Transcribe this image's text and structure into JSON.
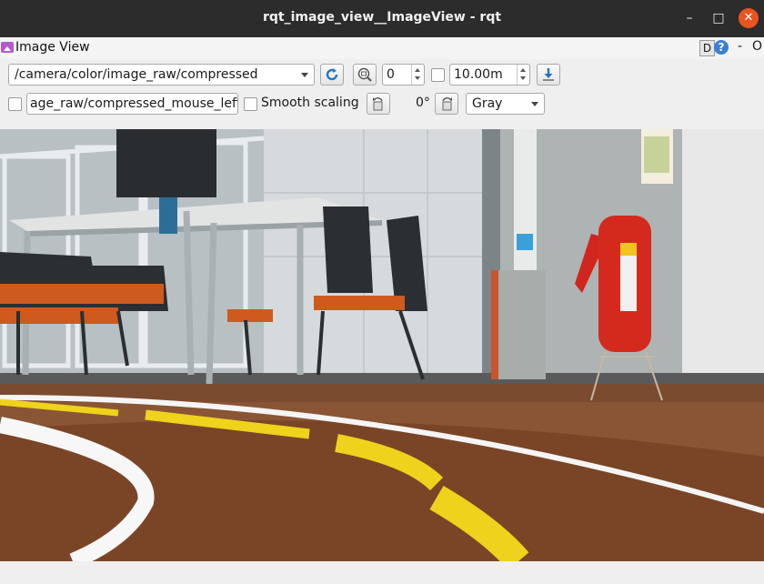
{
  "window": {
    "title": "rqt_image_view__ImageView - rqt",
    "minimize_icon": "minimize-icon",
    "maximize_icon": "maximize-icon",
    "close_icon": "close-icon",
    "minimize_glyph": "–",
    "maximize_glyph": "□",
    "close_glyph": "✕"
  },
  "plugin": {
    "title": "Image View",
    "d_label": "D",
    "help_label": "?",
    "dash_label": "-",
    "o_label": "O"
  },
  "toolbar": {
    "topic": "/camera/color/image_raw/compressed",
    "refresh_icon": "refresh-icon",
    "zoom_icon": "zoom-fit-icon",
    "spin_value": "0",
    "max_range_value": "10.00m",
    "save_icon": "save-icon",
    "mouse_topic": "age_raw/compressed_mouse_left",
    "smooth_scaling_label": "Smooth scaling",
    "rotate_left_icon": "rotate-left-icon",
    "rotation_value": "0°",
    "rotate_right_icon": "rotate-right-icon",
    "color_scheme": "Gray"
  },
  "image": {
    "description_icon": "camera-image",
    "floor_color": "#7a4a2c",
    "wall_color": "#dcdcdc",
    "line_yellow": "#f2d21a",
    "line_white": "#f7f7f7"
  }
}
